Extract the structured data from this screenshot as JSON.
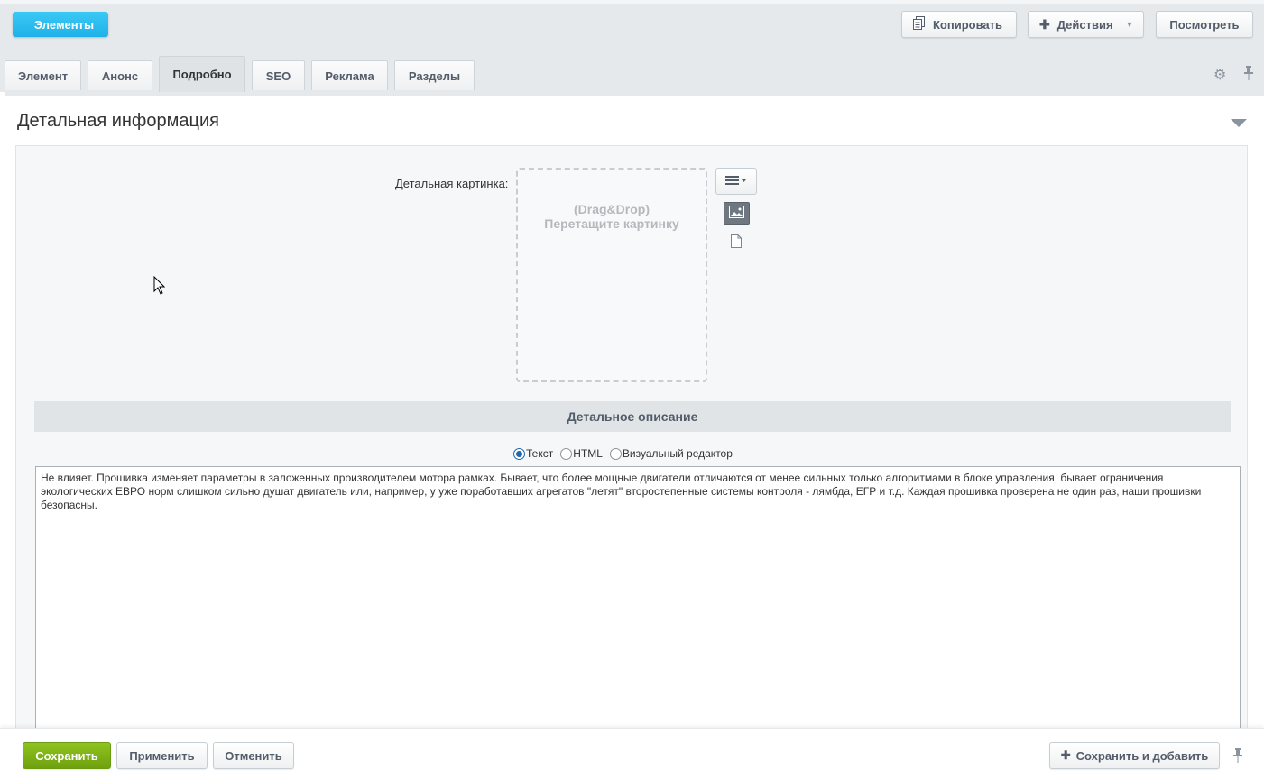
{
  "toolbar": {
    "elements_label": "Элементы",
    "copy_label": "Копировать",
    "actions_label": "Действия",
    "view_label": "Посмотреть"
  },
  "tabs": [
    {
      "label": "Элемент"
    },
    {
      "label": "Анонс"
    },
    {
      "label": "Подробно",
      "active": true
    },
    {
      "label": "SEO"
    },
    {
      "label": "Реклама"
    },
    {
      "label": "Разделы"
    }
  ],
  "section": {
    "title": "Детальная информация",
    "picture_label": "Детальная картинка:",
    "dropzone_line1": "(Drag&Drop)",
    "dropzone_line2": "Перетащите картинку",
    "description_header": "Детальное описание",
    "radio_text": "Текст",
    "radio_html": "HTML",
    "radio_visual": "Визуальный редактор",
    "selected_mode": "Текст",
    "description_text": "Не влияет. Прошивка изменяет параметры в заложенных производителем мотора рамках. Бывает, что более мощные двигатели отличаются от менее сильных только алгоритмами в блоке управления, бывает ограничения экологических ЕВРО норм слишком сильно душат двигатель или, например, у уже поработавших агрегатов \"летят\" второстепенные системы контроля - лямбда, ЕГР и т.д. Каждая прошивка проверена не один раз, наши прошивки безопасны."
  },
  "footer": {
    "save_label": "Сохранить",
    "apply_label": "Применить",
    "cancel_label": "Отменить",
    "save_add_label": "Сохранить и добавить"
  },
  "colors": {
    "accent_blue": "#1fb1e8",
    "save_green": "#7bb014",
    "toolbar_bg": "#e6e9ec"
  }
}
